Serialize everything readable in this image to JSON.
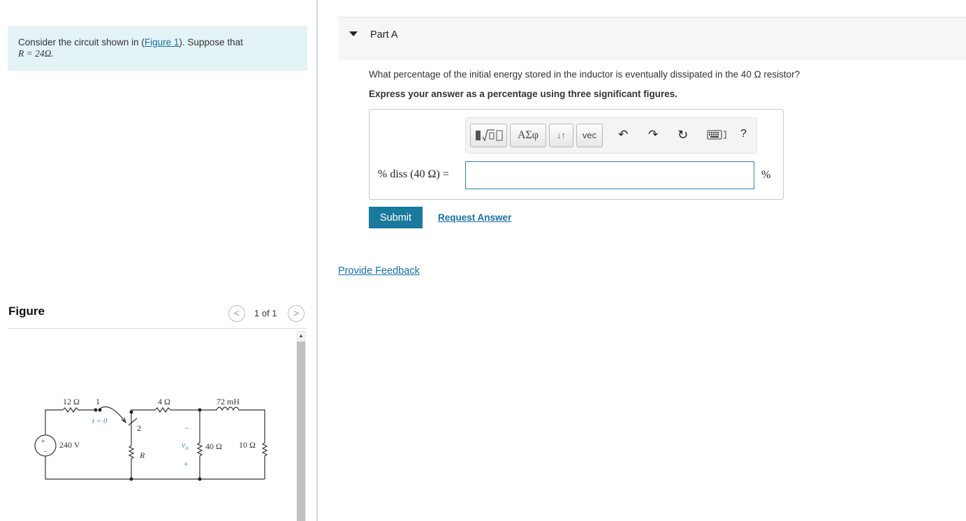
{
  "problem": {
    "text_before_link": "Consider the circuit shown in (",
    "figure_link": "Figure 1",
    "text_after_link": "). Suppose that",
    "condition": "R = 24Ω."
  },
  "figure": {
    "title": "Figure",
    "page_indicator": "1 of 1",
    "prev_icon": "chevron-left-icon",
    "next_icon": "chevron-right-icon",
    "circuit_labels": {
      "r12": "12 Ω",
      "pos1": "1",
      "pos2": "2",
      "t0": "t = 0",
      "r4": "4 Ω",
      "l72": "72 mH",
      "source": "240 V",
      "r": "R",
      "vo": "v",
      "vo_sub": "o",
      "minus": "−",
      "plus": "+",
      "r40": "40 Ω",
      "r10": "10 Ω",
      "src_plus": "+",
      "src_minus": "−"
    }
  },
  "part_a": {
    "title": "Part A",
    "question": "What percentage of the initial energy stored in the inductor is eventually dissipated in the 40 Ω resistor?",
    "instruction": "Express your answer as a percentage using three significant figures.",
    "toolbar": {
      "greek_label": "ΑΣφ",
      "arrows_label": "↓↑",
      "vec_label": "vec",
      "help_label": "?"
    },
    "equation_label": "% diss  (40 Ω) =",
    "answer_value": "",
    "unit": "%",
    "submit_label": "Submit",
    "request_answer_label": "Request Answer"
  },
  "feedback_label": "Provide Feedback",
  "colors": {
    "problem_bg": "#e4f3f6",
    "link": "#1a6ea6",
    "submit_bg": "#1a7a9e",
    "input_border": "#3e7ba3"
  }
}
